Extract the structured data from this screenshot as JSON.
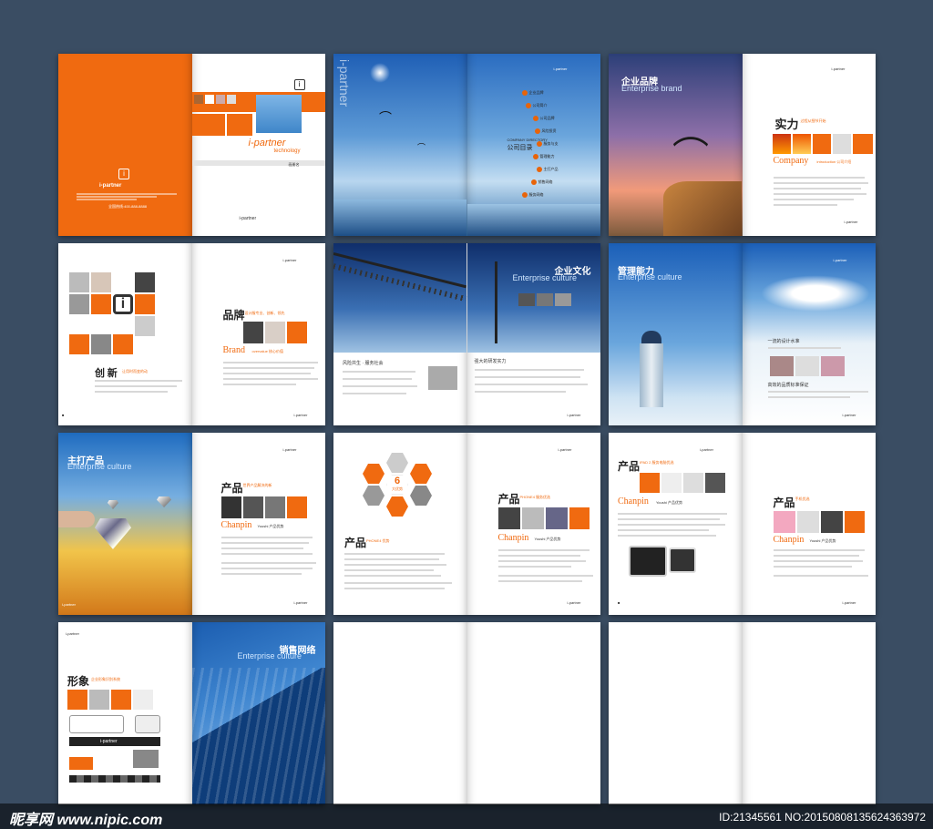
{
  "brand": {
    "name": "i-partner",
    "tagline": "technology",
    "short": "i-partner",
    "cn_tag": "■■■■"
  },
  "cover": {
    "hotline": "全国热线:400-888-8888",
    "back_tag": "画册名"
  },
  "directory": {
    "en": "COMPANY DIRECTORY",
    "cn": "公司目录",
    "items": [
      "企业品牌",
      "公司简介",
      "公司品牌",
      "风险投资",
      "服务与支",
      "管理能力",
      "主打产品",
      "销售网络",
      "服务网络"
    ],
    "vertical": "i-partner"
  },
  "brand_page": {
    "cn": "企业品牌",
    "en": "Enterprise brand",
    "strength": "实力",
    "strength_sub": "过程从细节开始",
    "company": "Company",
    "company_sub": "introduction 公司介绍"
  },
  "innovation": {
    "brand_cn": "品牌",
    "brand_sub": "设计服专业、创新、领先",
    "brand_en": "Brand",
    "brand_en_sub": "overvalue 核心价值",
    "create": "创 新",
    "create_sub": "让用时而变的动"
  },
  "culture": {
    "cn": "企业文化",
    "en": "Enterprise culture",
    "left_head": "风险共生 · 服务社会",
    "right_head": "强大的研发实力"
  },
  "management": {
    "cn": "管理能力",
    "en": "Enterprise culture",
    "h1": "一流的设计水准",
    "h2": "高效的品质标准保证"
  },
  "product1": {
    "cn": "主打产品",
    "en": "Enterprise culture",
    "title": "产品",
    "title_sub": "世界产品解决的新",
    "chanpin": "Chanpin",
    "chanpin_sub": "Youshi 产品优势"
  },
  "product2": {
    "title": "产品",
    "title_sub": "PHONE4 优势",
    "badge_num": "6",
    "badge_text": "大优势",
    "title_r": "产品",
    "title_r_sub": "PHONE4 服务优选",
    "chanpin": "Chanpin",
    "chanpin_sub": "Youshi 产品优势"
  },
  "product3": {
    "title": "产品",
    "title_sub": "IPAD 2 服务电脑优选",
    "chanpin": "Chanpin",
    "chanpin_sub": "Youshi 产品优势",
    "title_r": "产品",
    "title_r_sub": "手机优选",
    "chanpin_r": "Chanpin",
    "chanpin_r_sub": "Youshi 产品优势"
  },
  "image_page": {
    "title": "形象",
    "title_sub": "企业形象识别系统",
    "sales_cn": "销售网络",
    "sales_en": "Enterprise culture"
  },
  "watermark": {
    "site": "昵享网 www.nipic.com",
    "id": "ID:21345561 NO:20150808135624363972"
  },
  "colors": {
    "orange": "#f06a10",
    "background": "#3a4d63",
    "sky": "#3f7fc4"
  }
}
